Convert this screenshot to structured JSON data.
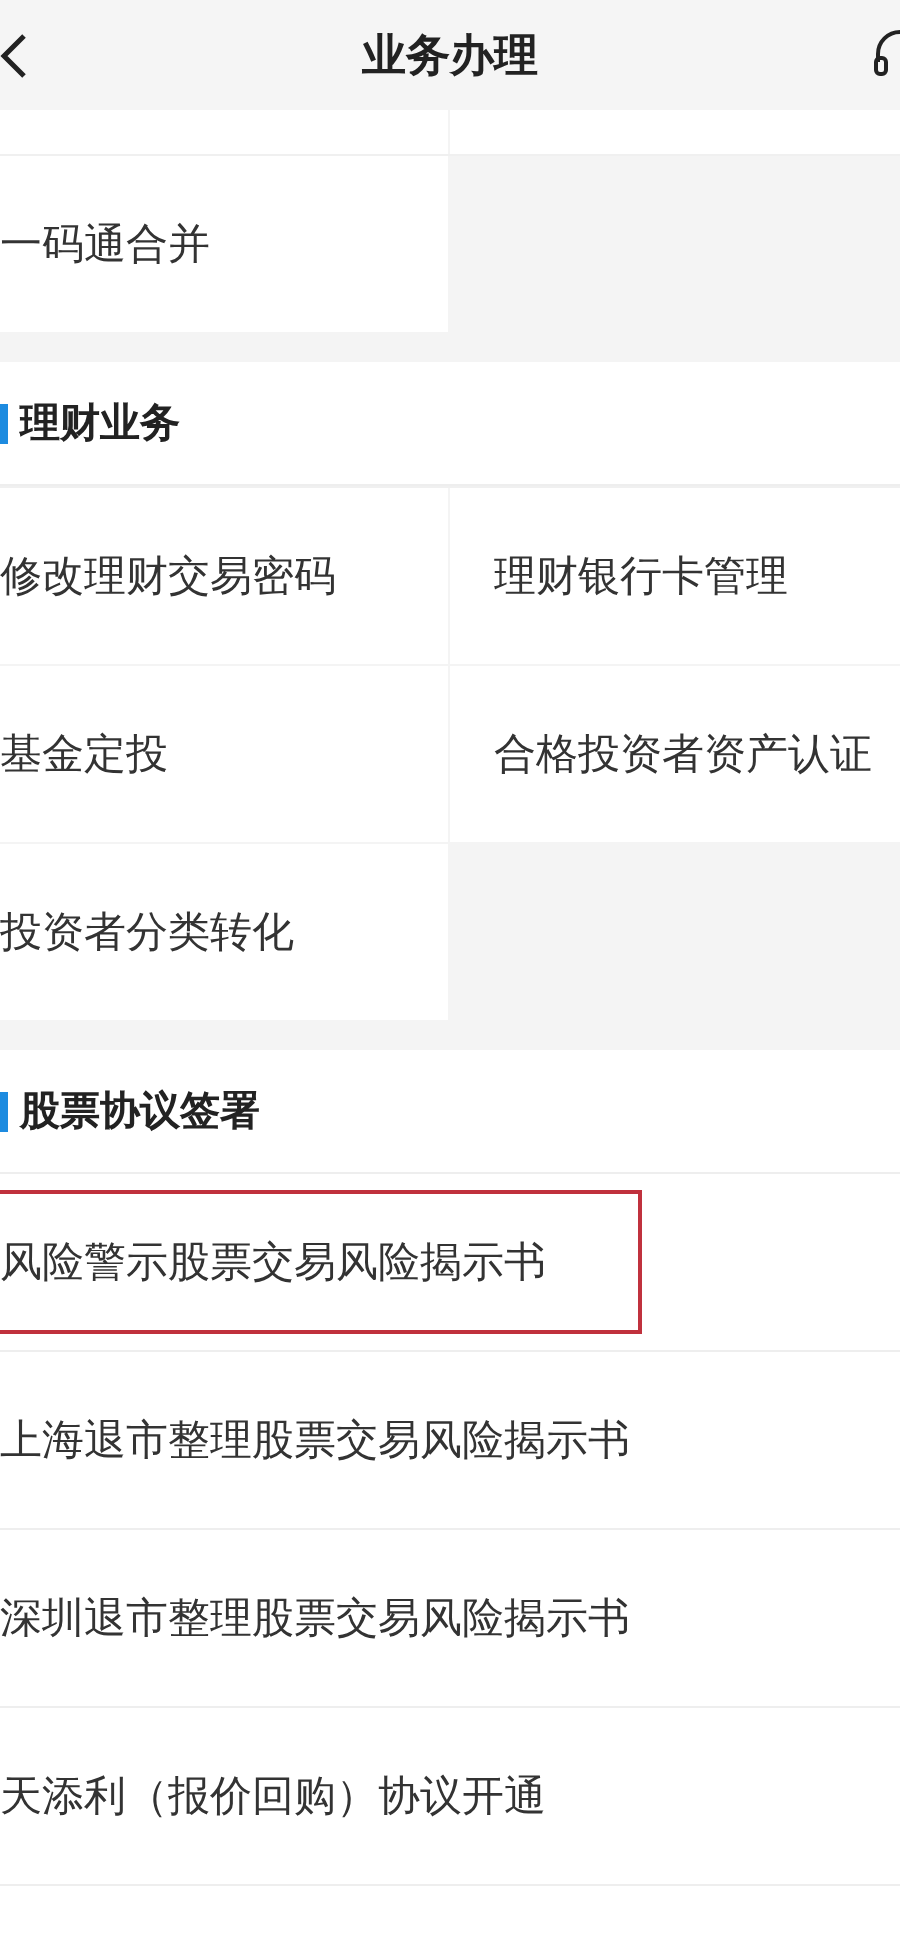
{
  "header": {
    "title": "业务办理"
  },
  "top_grid": {
    "items": [
      {
        "label": "一码通合并"
      }
    ]
  },
  "sections": [
    {
      "title": "理财业务",
      "kind": "grid",
      "items": [
        {
          "label": "修改理财交易密码"
        },
        {
          "label": "理财银行卡管理"
        },
        {
          "label": "基金定投"
        },
        {
          "label": "合格投资者资产认证"
        },
        {
          "label": "投资者分类转化"
        }
      ]
    },
    {
      "title": "股票协议签署",
      "kind": "list",
      "items": [
        {
          "label": "风险警示股票交易风险揭示书",
          "highlighted": true
        },
        {
          "label": "上海退市整理股票交易风险揭示书",
          "highlighted": false
        },
        {
          "label": "深圳退市整理股票交易风险揭示书",
          "highlighted": false
        },
        {
          "label": "天添利（报价回购）协议开通",
          "highlighted": false
        }
      ]
    }
  ]
}
